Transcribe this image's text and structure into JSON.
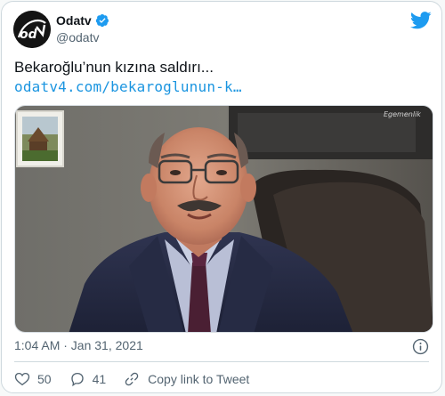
{
  "account": {
    "name": "Odatv",
    "handle": "@odatv",
    "avatar_text": "odatv"
  },
  "tweet": {
    "text": "Bekaroğlu’nun kızına saldırı...",
    "link": "odatv4.com/bekaroglunun-k…",
    "timestamp": "1:04 AM · Jan 31, 2021"
  },
  "actions": {
    "likes": "50",
    "replies": "41",
    "copy_link_label": "Copy link to Tweet"
  },
  "colors": {
    "link": "#1b95e0",
    "verified": "#1d9bf0",
    "twitter_bird": "#1d9bf0",
    "muted_text": "#536471"
  },
  "icons": {
    "verified": "verified-badge-icon",
    "bird": "twitter-bird-icon",
    "info": "info-icon",
    "like": "heart-icon",
    "reply": "comment-icon",
    "copy": "link-icon"
  }
}
